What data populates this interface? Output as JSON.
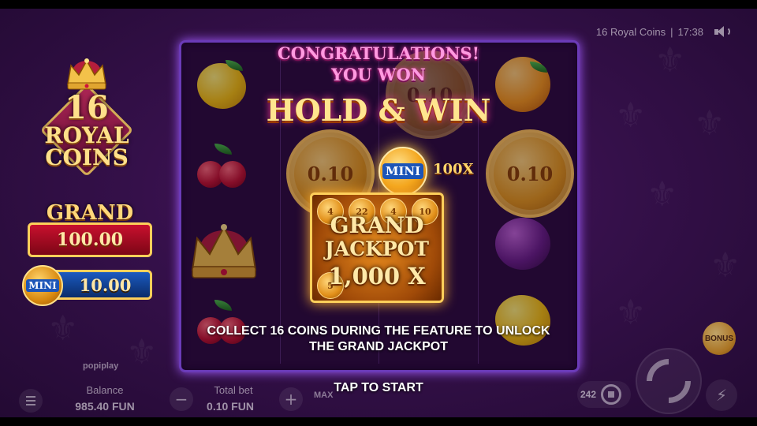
{
  "game": {
    "title": "16 Royal Coins",
    "time": "17:38",
    "separator": "|",
    "logo_number": "16",
    "logo_word1": "ROYAL",
    "logo_word2": "COINS",
    "provider": "popiplay"
  },
  "jackpots": {
    "grand_label": "GRAND",
    "grand_value": "100.00",
    "mini_label": "MINI",
    "mini_value": "10.00"
  },
  "reels": {
    "coin_values": [
      "0.10",
      "0.10",
      "0.10"
    ]
  },
  "overlay": {
    "congrats_line1": "CONGRATULATIONS!",
    "congrats_line2": "YOU WON",
    "feature_title": "HOLD & WIN",
    "mini_coin_label": "MINI",
    "mini_multiplier": "100X",
    "jackpot_line1": "GRAND",
    "jackpot_line2": "JACKPOT",
    "jackpot_line3": "1,000 X",
    "jackpot_coin_values": [
      "4",
      "22",
      "4",
      "10",
      "5"
    ],
    "collect_line1": "COLLECT 16 COINS DURING THE FEATURE TO UNLOCK",
    "collect_line2": "THE GRAND JACKPOT",
    "tap_to_start": "TAP TO START"
  },
  "hud": {
    "balance_label": "Balance",
    "balance_value": "985.40 FUN",
    "total_bet_label": "Total bet",
    "total_bet_value": "0.10 FUN",
    "minus": "−",
    "plus": "+",
    "max_label": "MAX",
    "autospin_count": "242",
    "bonus_label": "BONUS",
    "turbo_glyph": "⚡"
  },
  "colors": {
    "background": "#35104a",
    "reel_border": "#6b3bb8",
    "grand_red": "#c8102e",
    "mini_blue": "#1a5ac0",
    "gold": "#ffcf5a",
    "congrats_pink": "#ff9ae0"
  },
  "icons": [
    "menu-icon",
    "sound-icon",
    "spin-icon",
    "autospin-stop-icon",
    "turbo-icon",
    "crown-icon"
  ]
}
